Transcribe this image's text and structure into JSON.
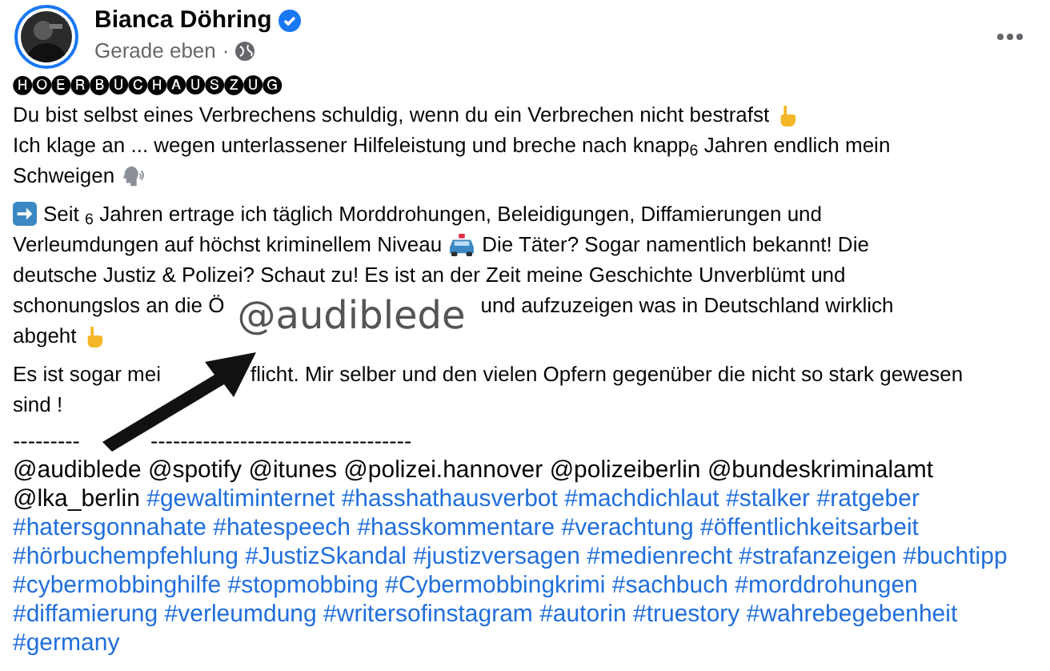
{
  "post": {
    "author": "Bianca Döhring",
    "verified": true,
    "time": "Gerade eben",
    "separator": "·",
    "title": "🅗🅞🅔🅡🅑🅤🅒🅗🅐🅤🅢🅩🅤🅖",
    "paragraphs": [
      [
        [
          {
            "kind": "text",
            "text": "Du bist selbst eines Verbrechens schuldig, wenn du ein Verbrechen nicht bestrafst"
          },
          {
            "kind": "hand"
          }
        ],
        [
          {
            "kind": "text",
            "text": "Ich klage an ... wegen unterlassener Hilfeleistung und breche nach knapp$_{6}$ Jahren endlich mein"
          }
        ],
        [
          {
            "kind": "text",
            "text": "Schweigen"
          },
          {
            "kind": "head"
          }
        ]
      ],
      [
        [
          {
            "kind": "arrow"
          },
          {
            "kind": "text",
            "text": "Seit $_{6}$ Jahren ertrage ich täglich Morddrohungen, Beleidigungen, Diffamierungen und"
          }
        ],
        [
          {
            "kind": "text",
            "text": "Verleumdungen auf höchst kriminellem Niveau"
          },
          {
            "kind": "car"
          },
          {
            "kind": "text",
            "text": "Die Täter? Sogar namentlich bekannt! Die"
          }
        ],
        [
          {
            "kind": "text",
            "text": "deutsche Justiz & Polizei? Schaut zu! Es ist an der Zeit meine Geschichte Unverblümt und"
          }
        ],
        [
          {
            "kind": "text",
            "text": "schonungslos an die Ö"
          },
          {
            "kind": "overlay",
            "text": "@audiblede"
          },
          {
            "kind": "text",
            "text": "und aufzuzeigen was in Deutschland wirklich"
          }
        ],
        [
          {
            "kind": "text",
            "text": "abgeht"
          },
          {
            "kind": "hand"
          }
        ]
      ],
      [
        [
          {
            "kind": "text",
            "text": "Es ist sogar mei"
          },
          {
            "kind": "covered"
          },
          {
            "kind": "text",
            "text": "flicht. Mir selber und den vielen Opfern gegenüber die nicht so stark gewesen"
          }
        ],
        [
          {
            "kind": "text",
            "text": "sind !"
          }
        ]
      ]
    ],
    "divider": [
      "---------",
      "-----------------------------------"
    ],
    "tags": [
      {
        "kind": "mention",
        "text": "@audiblede"
      },
      {
        "kind": "mention",
        "text": "@spotify"
      },
      {
        "kind": "mention",
        "text": "@itunes"
      },
      {
        "kind": "mention",
        "text": "@polizei.hannover"
      },
      {
        "kind": "mention",
        "text": "@polizeiberlin"
      },
      {
        "kind": "mention",
        "text": "@bundeskriminalamt"
      },
      {
        "kind": "mention",
        "text": "@lka_berlin"
      },
      {
        "kind": "hashtag",
        "text": "#gewaltiminternet"
      },
      {
        "kind": "hashtag",
        "text": "#hasshathausverbot"
      },
      {
        "kind": "hashtag",
        "text": "#machdichlaut"
      },
      {
        "kind": "hashtag",
        "text": "#stalker"
      },
      {
        "kind": "hashtag",
        "text": "#ratgeber"
      },
      {
        "kind": "hashtag",
        "text": "#hatersgonnahate"
      },
      {
        "kind": "hashtag",
        "text": "#hatespeech"
      },
      {
        "kind": "hashtag",
        "text": "#hasskommentare"
      },
      {
        "kind": "hashtag",
        "text": "#verachtung"
      },
      {
        "kind": "hashtag",
        "text": "#öffentlichkeitsarbeit"
      },
      {
        "kind": "hashtag",
        "text": "#hörbuchempfehlung"
      },
      {
        "kind": "hashtag",
        "text": "#JustizSkandal"
      },
      {
        "kind": "hashtag",
        "text": "#justizversagen"
      },
      {
        "kind": "hashtag",
        "text": "#medienrecht"
      },
      {
        "kind": "hashtag",
        "text": "#strafanzeigen"
      },
      {
        "kind": "hashtag",
        "text": "#buchtipp"
      },
      {
        "kind": "hashtag",
        "text": "#cybermobbinghilfe"
      },
      {
        "kind": "hashtag",
        "text": "#stopmobbing"
      },
      {
        "kind": "hashtag",
        "text": "#Cybermobbingkrimi"
      },
      {
        "kind": "hashtag",
        "text": "#sachbuch"
      },
      {
        "kind": "hashtag",
        "text": "#morddrohungen"
      },
      {
        "kind": "hashtag",
        "text": "#diffamierung"
      },
      {
        "kind": "hashtag",
        "text": "#verleumdung"
      },
      {
        "kind": "hashtag",
        "text": "#writersofinstagram"
      },
      {
        "kind": "hashtag",
        "text": "#autorin"
      },
      {
        "kind": "hashtag",
        "text": "#truestory"
      },
      {
        "kind": "hashtag",
        "text": "#wahrebegebenheit"
      },
      {
        "kind": "hashtag",
        "text": "#germany"
      }
    ]
  }
}
